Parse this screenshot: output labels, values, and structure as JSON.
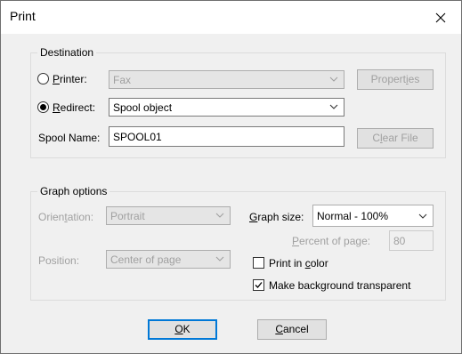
{
  "window": {
    "title": "Print",
    "close_glyph": "✕"
  },
  "destination": {
    "group_label": "Destination",
    "printer_prefix": "",
    "printer_u": "P",
    "printer_rest": "rinter:",
    "printer_selected": false,
    "printer_value": "Fax",
    "properties_pre": "Propert",
    "properties_u": "i",
    "properties_post": "es",
    "redirect_u": "R",
    "redirect_rest": "edirect:",
    "redirect_selected": true,
    "redirect_value": "Spool object",
    "spool_label": "Spool Name:",
    "spool_value": "SPOOL01",
    "clear_pre": "C",
    "clear_u": "l",
    "clear_post": "ear File"
  },
  "graph": {
    "group_label": "Graph options",
    "orientation_pre": "Orien",
    "orientation_u": "t",
    "orientation_post": "ation:",
    "orientation_value": "Portrait",
    "graph_size_u": "G",
    "graph_size_rest": "raph size:",
    "graph_size_value": "Normal - 100%",
    "percent_u": "P",
    "percent_rest": "ercent of page:",
    "percent_value": "80",
    "position_label": "Position:",
    "position_value": "Center of page",
    "print_color_pre": "Print in ",
    "print_color_u": "c",
    "print_color_post": "olor",
    "print_color_checked": false,
    "transparent_label": "Make background transparent",
    "transparent_checked": true
  },
  "buttons": {
    "ok_u": "O",
    "ok_rest": "K",
    "cancel_u": "C",
    "cancel_rest": "ancel"
  }
}
